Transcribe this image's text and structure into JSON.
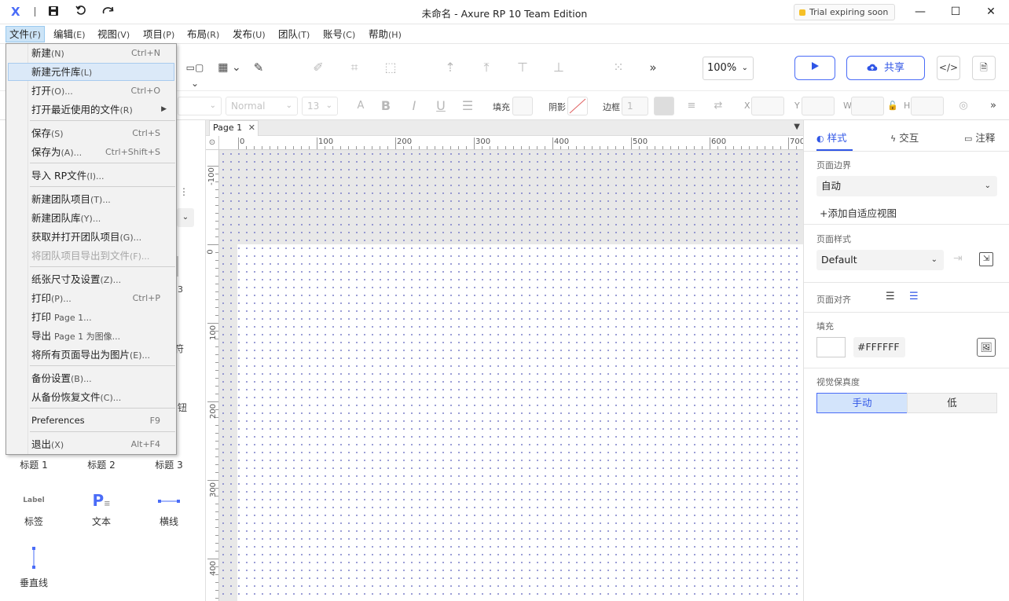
{
  "app": {
    "logo": "X",
    "title": "未命名 - Axure RP 10 Team Edition",
    "trial": "Trial expiring soon"
  },
  "menubar": [
    {
      "label": "文件",
      "hotkey": "(F)"
    },
    {
      "label": "编辑",
      "hotkey": "(E)"
    },
    {
      "label": "视图",
      "hotkey": "(V)"
    },
    {
      "label": "项目",
      "hotkey": "(P)"
    },
    {
      "label": "布局",
      "hotkey": "(R)"
    },
    {
      "label": "发布",
      "hotkey": "(U)"
    },
    {
      "label": "团队",
      "hotkey": "(T)"
    },
    {
      "label": "账号",
      "hotkey": "(C)"
    },
    {
      "label": "帮助",
      "hotkey": "(H)"
    }
  ],
  "file_menu": {
    "items": [
      {
        "label": "新建",
        "hotkey": "(N)",
        "shortcut": "Ctrl+N"
      },
      {
        "label": "新建元件库",
        "hotkey": "(L)",
        "shortcut": ""
      },
      {
        "label": "打开",
        "hotkey": "(O)...",
        "shortcut": "Ctrl+O"
      },
      {
        "label": "打开最近使用的文件",
        "hotkey": "(R)",
        "shortcut": ""
      },
      {
        "label": "保存",
        "hotkey": "(S)",
        "shortcut": "Ctrl+S"
      },
      {
        "label": "保存为",
        "hotkey": "(A)...",
        "shortcut": "Ctrl+Shift+S"
      },
      {
        "label": "导入 RP文件",
        "hotkey": "(I)...",
        "shortcut": ""
      },
      {
        "label": "新建团队项目",
        "hotkey": "(T)...",
        "shortcut": ""
      },
      {
        "label": "新建团队库",
        "hotkey": "(Y)...",
        "shortcut": ""
      },
      {
        "label": "获取并打开团队项目",
        "hotkey": "(G)...",
        "shortcut": ""
      },
      {
        "label": "将团队项目导出到文件",
        "hotkey": "(F)...",
        "shortcut": ""
      },
      {
        "label": "纸张尺寸及设置",
        "hotkey": "(Z)...",
        "shortcut": ""
      },
      {
        "label": "打印",
        "hotkey": "(P)...",
        "shortcut": "Ctrl+P"
      },
      {
        "label": "打印 ",
        "hotkey": "Page 1...",
        "shortcut": ""
      },
      {
        "label": "导出 ",
        "hotkey": "Page 1 为图像...",
        "shortcut": ""
      },
      {
        "label": "将所有页面导出为图片",
        "hotkey": "(E)...",
        "shortcut": ""
      },
      {
        "label": "备份设置",
        "hotkey": "(B)...",
        "shortcut": ""
      },
      {
        "label": "从备份恢复文件",
        "hotkey": "(C)...",
        "shortcut": ""
      },
      {
        "label": "Preferences",
        "hotkey": "",
        "shortcut": "F9"
      },
      {
        "label": "退出",
        "hotkey": "(X)",
        "shortcut": "Alt+F4"
      }
    ]
  },
  "toolbar": {
    "zoom": "100%",
    "share": "共享",
    "font_style": "Normal",
    "font_size": "13",
    "fill_label": "填充",
    "shadow_label": "阴影",
    "border_label": "边框",
    "border_value": "1",
    "x_label": "X",
    "y_label": "Y",
    "w_label": "W",
    "h_label": "H"
  },
  "canvas": {
    "tab": "Page 1",
    "ruler_top": [
      "0",
      "100",
      "200",
      "300",
      "400",
      "500",
      "600",
      "700"
    ],
    "ruler_left": [
      "-100",
      "0",
      "100",
      "200",
      "300",
      "400"
    ]
  },
  "widgets": [
    {
      "label": "标题 1",
      "icon": ""
    },
    {
      "label": "标题 2",
      "icon": ""
    },
    {
      "label": "标题 3",
      "icon": ""
    },
    {
      "label": "标签",
      "icon": "Label"
    },
    {
      "label": "文本",
      "icon": "P"
    },
    {
      "label": "横线",
      "icon": ""
    },
    {
      "label": "垂直线",
      "icon": ""
    }
  ],
  "partial_labels": {
    "a": "3",
    "b": "符",
    "c": "钮"
  },
  "right_panel": {
    "tabs": [
      "样式",
      "交互",
      "注释"
    ],
    "page_bounds_label": "页面边界",
    "page_bounds_value": "自动",
    "add_adaptive": "添加自适应视图",
    "page_style_label": "页面样式",
    "page_style_value": "Default",
    "page_align_label": "页面对齐",
    "fill_label": "填充",
    "fill_value": "#FFFFFF",
    "fidelity_label": "视觉保真度",
    "fidelity_options": [
      "手动",
      "低"
    ]
  },
  "colors": {
    "accent": "#2f55e6",
    "menu_highlight": "#dbe9f8"
  }
}
